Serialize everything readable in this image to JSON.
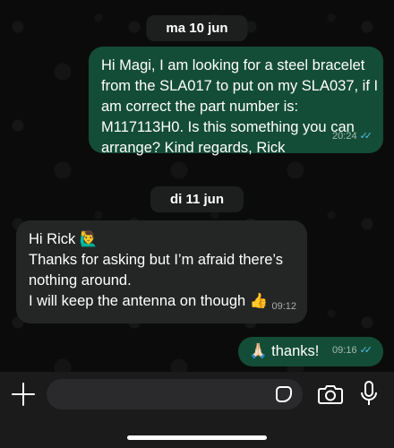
{
  "colors": {
    "outgoing_bubble": "#144d37",
    "incoming_bubble": "#242626",
    "read_ticks": "#53bdeb",
    "background": "#0b0b0b"
  },
  "chat": {
    "date_1": "ma 10 jun",
    "message_1": {
      "lines": [
        "Hi Magi, I am looking for a steel bracelet",
        "from the SLA017 to put on my SLA037, if I",
        "am correct the part number is:",
        "M117113H0. Is this something you can",
        "arrange? Kind regards, Rick"
      ],
      "time": "20:24",
      "status": "read"
    },
    "date_2": "di 11 jun",
    "message_2": {
      "lines": [
        "Hi Rick 🙋‍♂️",
        "Thanks for asking but I’m afraid there’s",
        "nothing around.",
        "I will keep the antenna on though 👍"
      ],
      "time": "09:12"
    },
    "message_3": {
      "text": "🙏🏻 thanks!",
      "time": "09:16",
      "status": "read"
    }
  },
  "composer": {
    "placeholder": "",
    "icons": [
      "plus-icon",
      "sticker-icon",
      "camera-icon",
      "microphone-icon"
    ]
  },
  "ticks_glyph": "✓✓"
}
